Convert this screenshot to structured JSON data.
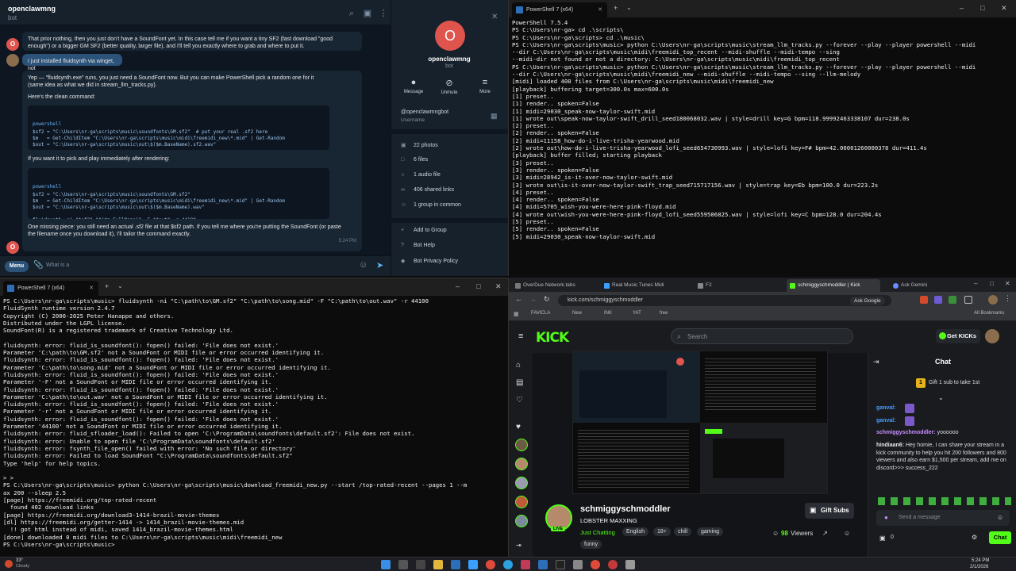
{
  "telegram": {
    "chat_title": "openclawmng",
    "chat_subtitle": "bot",
    "messages": [
      {
        "avatar": "O",
        "text": "That prior nothing, then you just don't have a SoundFont yet. In this case tell me if you want a tiny SF2 (fast download \"good enough\") or a bigger GM SF2 (better quality, larger file), and I'll tell you exactly where to grab and where to put it.",
        "time": "5:13 PM"
      },
      {
        "avatar": "",
        "text": "I just installed fluidsynth via winget, not",
        "time": ""
      },
      {
        "avatar": "O",
        "text": "Yep — \"fluidsynth.exe\" runs, you just need a SoundFont now. But you can make PowerShell pick a random one for it (same idea as what we did in stream_llm_tracks.py).",
        "time": ""
      }
    ],
    "pick_heading": "Here's the clean command:",
    "code1_lang": "powershell",
    "code1": "$sf2 = \"C:\\Users\\nr-ga\\scripts\\music\\soundfonts\\GM.sf2\"  # put your real .sf2 here\n$m   = Get-ChildItem \"C:\\Users\\nr-ga\\scripts\\music\\midi\\freemidi_new\\*.mid\" | Get-Random\n$out = \"C:\\Users\\nr-ga\\scripts\\music\\out\\$($m.BaseName).sf2.wav\"\n\nfluidsynth -ni \"$sf2\" \"$($m.FullName)\" -F \"$out\" -r 44100",
    "pick_text": "If you want it to pick and play immediately after rendering:",
    "code2_lang": "powershell",
    "code2": "$sf2 = \"C:\\Users\\nr-ga\\scripts\\music\\soundfonts\\GM.sf2\"\n$m   = Get-ChildItem \"C:\\Users\\nr-ga\\scripts\\music\\midi\\freemidi_new\\*.mid\" | Get-Random\n$out = \"C:\\Users\\nr-ga\\scripts\\music\\out\\$($m.BaseName).wav\"\n\nfluidsynth -ni \"$sf2\" \"$($m.FullName)\" -F \"$out\" -r 44100\nStart-Process -Command \"(System.Media.SoundPlayer]::new('$out').PlaySync()\"",
    "last_msg": "One missing piece: you still need an actual .sf2 file at that $sf2 path. If you tell me where you're putting the SoundFont (or paste the filename once you download it), I'll tailor the command exactly.",
    "last_time": "5:24 PM",
    "menu_label": "Menu",
    "input_value": "What is a",
    "side": {
      "avatar_letter": "O",
      "name": "openclawmng",
      "status": "bot",
      "actions": [
        "Message",
        "Unmute",
        "More"
      ],
      "username": "@openclawmngbot",
      "username_label": "Username",
      "media": [
        "22 photos",
        "6 files",
        "1 audio file",
        "406 shared links",
        "1 group in common"
      ],
      "links": [
        "Add to Group",
        "Bot Help",
        "Bot Privacy Policy"
      ]
    }
  },
  "ps_top": {
    "tab_title": "PowerShell 7 (x64)",
    "lines": [
      {
        "c": "w",
        "t": "PowerShell 7.5.4"
      },
      {
        "c": "w",
        "t": "PS C:\\Users\\nr-ga> cd .\\scripts\\"
      },
      {
        "c": "w",
        "t": "PS C:\\Users\\nr-ga\\scripts> cd .\\music\\"
      },
      {
        "c": "w",
        "t": "PS C:\\Users\\nr-ga\\scripts\\music> python C:\\Users\\nr-ga\\scripts\\music\\stream_llm_tracks.py --forever --play --player powershell --midi"
      },
      {
        "c": "w",
        "t": "--dir C:\\Users\\nr-ga\\scripts\\music\\midi\\freemidi_top_recent --midi-shuffle --midi-tempo --sing"
      },
      {
        "c": "w",
        "t": "--midi-dir not found or not a directory: C:\\Users\\nr-ga\\scripts\\music\\midi\\freemidi_top_recent"
      },
      {
        "c": "w",
        "t": "PS C:\\Users\\nr-ga\\scripts\\music> python C:\\Users\\nr-ga\\scripts\\music\\stream_llm_tracks.py --forever --play --player powershell --midi"
      },
      {
        "c": "w",
        "t": "--dir C:\\Users\\nr-ga\\scripts\\music\\midi\\freemidi_new --midi-shuffle --midi-tempo --sing --llm-melody"
      },
      {
        "c": "w",
        "t": "[midi] loaded 408 files from C:\\Users\\nr-ga\\scripts\\music\\midi\\freemidi_new"
      },
      {
        "c": "w",
        "t": "[playback] buffering target=300.0s max=600.0s"
      },
      {
        "c": "w",
        "t": "[1] preset.."
      },
      {
        "c": "w",
        "t": "[1] render.. spoken=False"
      },
      {
        "c": "w",
        "t": "[1] midi=29030_speak-now-taylor-swift.mid"
      },
      {
        "c": "w",
        "t": "[1] wrote out\\speak-now-taylor-swift_drill_seed180068032.wav | style=drill key=G bpm=118.99992463338107 dur=238.0s"
      },
      {
        "c": "w",
        "t": "[2] preset.."
      },
      {
        "c": "w",
        "t": "[2] render.. spoken=False"
      },
      {
        "c": "w",
        "t": "[2] midi=11158_how-do-i-live-trisha-yearwood.mid"
      },
      {
        "c": "w",
        "t": "[2] wrote out\\how-do-i-live-trisha-yearwood_lofi_seed654730993.wav | style=lofi key=F# bpm=42.00001260000378 dur=411.4s"
      },
      {
        "c": "w",
        "t": "[playback] buffer filled; starting playback"
      },
      {
        "c": "w",
        "t": "[3] preset.."
      },
      {
        "c": "w",
        "t": "[3] render.. spoken=False"
      },
      {
        "c": "w",
        "t": "[3] midi=28942_is-it-over-now-taylor-swift.mid"
      },
      {
        "c": "w",
        "t": "[3] wrote out\\is-it-over-now-taylor-swift_trap_seed715717156.wav | style=trap key=Eb bpm=100.0 dur=223.2s"
      },
      {
        "c": "w",
        "t": "[4] preset.."
      },
      {
        "c": "w",
        "t": "[4] render.. spoken=False"
      },
      {
        "c": "w",
        "t": "[4] midi=5705_wish-you-were-here-pink-floyd.mid"
      },
      {
        "c": "w",
        "t": "[4] wrote out\\wish-you-were-here-pink-floyd_lofi_seed559506825.wav | style=lofi key=C bpm=128.0 dur=204.4s"
      },
      {
        "c": "w",
        "t": "[5] preset.."
      },
      {
        "c": "w",
        "t": "[5] render.. spoken=False"
      },
      {
        "c": "w",
        "t": "[5] midi=29030_speak-now-taylor-swift.mid"
      }
    ]
  },
  "ps_bottom": {
    "tab_title": "PowerShell 7 (x64)",
    "lines": [
      {
        "c": "w",
        "t": "PS C:\\Users\\nr-ga\\scripts\\music> fluidsynth -ni \"C:\\path\\to\\GM.sf2\" \"C:\\path\\to\\song.mid\" -F \"C:\\path\\to\\out.wav\" -r 44100"
      },
      {
        "c": "w",
        "t": "FluidSynth runtime version 2.4.7"
      },
      {
        "c": "w",
        "t": "Copyright (C) 2000-2025 Peter Hanappe and others."
      },
      {
        "c": "w",
        "t": "Distributed under the LGPL license."
      },
      {
        "c": "w",
        "t": "SoundFont(R) is a registered trademark of Creative Technology Ltd."
      },
      {
        "c": "w",
        "t": ""
      },
      {
        "c": "w",
        "t": "fluidsynth: error: fluid_is_soundfont(): fopen() failed: 'File does not exist.'"
      },
      {
        "c": "w",
        "t": "Parameter 'C:\\path\\to\\GM.sf2' not a SoundFont or MIDI file or error occurred identifying it."
      },
      {
        "c": "w",
        "t": "fluidsynth: error: fluid_is_soundfont(): fopen() failed: 'File does not exist.'"
      },
      {
        "c": "w",
        "t": "Parameter 'C:\\path\\to\\song.mid' not a SoundFont or MIDI file or error occurred identifying it."
      },
      {
        "c": "w",
        "t": "fluidsynth: error: fluid_is_soundfont(): fopen() failed: 'File does not exist.'"
      },
      {
        "c": "w",
        "t": "Parameter '-F' not a SoundFont or MIDI file or error occurred identifying it."
      },
      {
        "c": "w",
        "t": "fluidsynth: error: fluid_is_soundfont(): fopen() failed: 'File does not exist.'"
      },
      {
        "c": "w",
        "t": "Parameter 'C:\\path\\to\\out.wav' not a SoundFont or MIDI file or error occurred identifying it."
      },
      {
        "c": "w",
        "t": "fluidsynth: error: fluid_is_soundfont(): fopen() failed: 'File does not exist.'"
      },
      {
        "c": "w",
        "t": "Parameter '-r' not a SoundFont or MIDI file or error occurred identifying it."
      },
      {
        "c": "w",
        "t": "fluidsynth: error: fluid_is_soundfont(): fopen() failed: 'File does not exist.'"
      },
      {
        "c": "w",
        "t": "Parameter '44100' not a SoundFont or MIDI file or error occurred identifying it."
      },
      {
        "c": "w",
        "t": "fluidsynth: error: fluid_sfloader_load(): Failed to open 'C:\\ProgramData\\soundfonts\\default.sf2': File does not exist."
      },
      {
        "c": "w",
        "t": "fluidsynth: error: Unable to open file 'C:\\ProgramData\\soundfonts\\default.sf2'"
      },
      {
        "c": "w",
        "t": "fluidsynth: error: fsynth_file_open() failed with error: 'No such file or directory'"
      },
      {
        "c": "w",
        "t": "fluidsynth: error: Failed to load SoundFont \"C:\\ProgramData\\soundfonts\\default.sf2\""
      },
      {
        "c": "w",
        "t": "Type 'help' for help topics."
      },
      {
        "c": "w",
        "t": ""
      },
      {
        "c": "w",
        "t": "> >"
      },
      {
        "c": "w",
        "t": "PS C:\\Users\\nr-ga\\scripts\\music> python C:\\Users\\nr-ga\\scripts\\music\\download_freemidi_new.py --start /top-rated-recent --pages 1 --m"
      },
      {
        "c": "w",
        "t": "ax 200 --sleep 2.5"
      },
      {
        "c": "w",
        "t": "[page] https://freemidi.org/top-rated-recent"
      },
      {
        "c": "w",
        "t": "  found 402 download links"
      },
      {
        "c": "w",
        "t": "[page] https://freemidi.org/download3-1414-brazil-movie-themes"
      },
      {
        "c": "w",
        "t": "[dl] https://freemidi.org/getter-1414 -> 1414_brazil-movie-themes.mid"
      },
      {
        "c": "w",
        "t": "  !! got html instead of midi, saved 1414_brazil-movie-themes.html"
      },
      {
        "c": "w",
        "t": "[done] downloaded 0 midi files to C:\\Users\\nr-ga\\scripts\\music\\midi\\freemidi_new"
      },
      {
        "c": "w",
        "t": "PS C:\\Users\\nr-ga\\scripts\\music> "
      }
    ]
  },
  "browser": {
    "tabs": [
      "OverDue Network.tabs",
      "Real Music Tunes Midi",
      "F2",
      "schmiggyschmoddler | Kick",
      "Ask Gemini"
    ],
    "url": "kick.com/schmiggyschmoddler",
    "ask_google": "Ask Google",
    "bookmarks": [
      "FAVICLA",
      "New",
      "INK",
      "YAT",
      "free"
    ],
    "all_bookmarks": "All Bookmarks",
    "kick_logo": "KICK",
    "search_placeholder": "Search",
    "get_kicks": "Get KICKs",
    "streamer": {
      "name": "schmiggyschmoddler",
      "title": "LOBSTER MAXXING",
      "category": "Just Chatting",
      "tags": [
        "English",
        "18+",
        "chill",
        "gaming",
        "funny"
      ],
      "viewers": "98",
      "viewers_label": "Viewers",
      "live": "LIVE",
      "gift_subs": "Gift Subs"
    },
    "chat": {
      "title": "Chat",
      "gift_banner": "Gift 1 sub to take 1st",
      "messages": [
        {
          "user": "ganval:",
          "text": ""
        },
        {
          "user": "ganval:",
          "text": ""
        },
        {
          "user": "schmiggyschmoddler:",
          "text": "yoooooo"
        },
        {
          "user": "hindiaan6:",
          "text": "Hey homie, I can share your stream in a kick community to help you hit 200 followers and 800 viewers and also earn $1,500 per stream, add me on discord>>> success_222"
        }
      ],
      "input_placeholder": "Send a message",
      "points": "0",
      "send": "Chat"
    }
  },
  "taskbar": {
    "weather_temp": "33°",
    "weather_desc": "Cloudy",
    "time": "5:24 PM",
    "date": "2/1/2026"
  }
}
